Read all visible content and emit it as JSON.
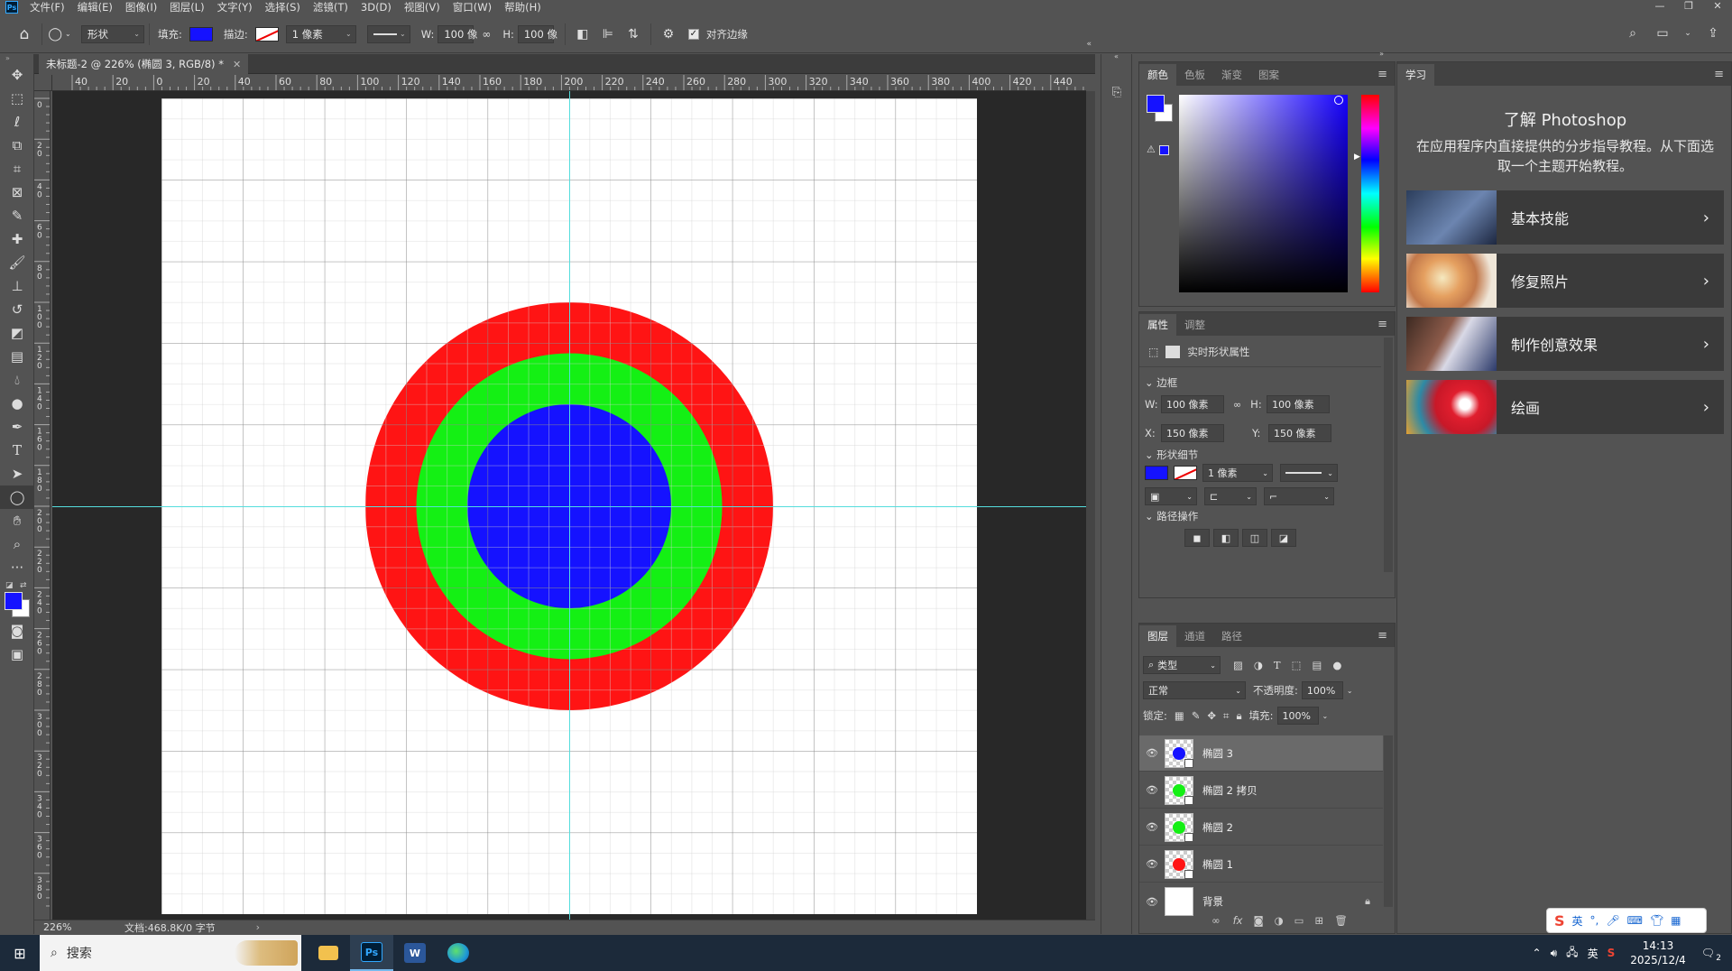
{
  "app": {
    "logo": "Ps"
  },
  "menu": [
    "文件(F)",
    "编辑(E)",
    "图像(I)",
    "图层(L)",
    "文字(Y)",
    "选择(S)",
    "滤镜(T)",
    "3D(D)",
    "视图(V)",
    "窗口(W)",
    "帮助(H)"
  ],
  "options": {
    "shape_mode": "形状",
    "fill_label": "填充:",
    "fill_color": "#1512ff",
    "stroke_label": "描边:",
    "stroke_width": "1 像素",
    "w_label": "W:",
    "w_value": "100 像",
    "h_label": "H:",
    "h_value": "100 像",
    "align_edges_label": "对齐边缘"
  },
  "document": {
    "tab_title": "未标题-2 @ 226% (椭圆 3, RGB/8) *",
    "ruler_h_ticks": [
      "40",
      "20",
      "0",
      "20",
      "40",
      "60",
      "80",
      "100",
      "120",
      "140",
      "160",
      "180",
      "200",
      "220",
      "240",
      "260",
      "280",
      "300",
      "320",
      "340",
      "360",
      "380",
      "400",
      "420",
      "440"
    ],
    "ruler_v_ticks": [
      "0",
      "2\n0",
      "4\n0",
      "6\n0",
      "8\n0",
      "1\n0\n0",
      "1\n2\n0",
      "1\n4\n0",
      "1\n6\n0",
      "1\n8\n0",
      "2\n0\n0",
      "2\n2\n0",
      "2\n4\n0",
      "2\n6\n0",
      "2\n8\n0",
      "3\n0\n0",
      "3\n2\n0",
      "3\n4\n0",
      "3\n6\n0",
      "3\n8\n0"
    ],
    "colors": {
      "outer": "#ff1414",
      "middle": "#14f014",
      "inner": "#1512ff",
      "guide": "#55dddd"
    }
  },
  "status": {
    "zoom": "226%",
    "doc_info": "文档:468.8K/0 字节",
    "arrow": "›"
  },
  "color_panel": {
    "tabs": [
      "颜色",
      "色板",
      "渐变",
      "图案"
    ],
    "fg": "#1512ff",
    "bg": "#ffffff"
  },
  "props_panel": {
    "tabs": [
      "属性",
      "调整"
    ],
    "header": "实时形状属性",
    "bounds_title": "边框",
    "w_label": "W:",
    "w_value": "100 像素",
    "h_label": "H:",
    "h_value": "100 像素",
    "x_label": "X:",
    "x_value": "150 像素",
    "y_label": "Y:",
    "y_value": "150 像素",
    "shape_title": "形状细节",
    "stroke_width": "1 像素",
    "path_ops_title": "路径操作"
  },
  "layers_panel": {
    "tabs": [
      "图层",
      "通道",
      "路径"
    ],
    "filter_label": "类型",
    "blend_mode": "正常",
    "opacity_label": "不透明度:",
    "opacity_value": "100%",
    "lock_label": "锁定:",
    "fill_label": "填充:",
    "fill_value": "100%",
    "layers": [
      {
        "name": "椭圆 3",
        "color": "#1512ff",
        "selected": true
      },
      {
        "name": "椭圆 2 拷贝",
        "color": "#14f014",
        "selected": false
      },
      {
        "name": "椭圆 2",
        "color": "#14f014",
        "selected": false
      },
      {
        "name": "椭圆 1",
        "color": "#ff1414",
        "selected": false
      },
      {
        "name": "背景",
        "color": "",
        "selected": false
      }
    ]
  },
  "learn_panel": {
    "tab": "学习",
    "title": "了解 Photoshop",
    "desc": "在应用程序内直接提供的分步指导教程。从下面选取一个主题开始教程。",
    "cards": [
      "基本技能",
      "修复照片",
      "制作创意效果",
      "绘画"
    ]
  },
  "taskbar": {
    "search_placeholder": "搜索",
    "ime_lang": "英",
    "time": "14:13",
    "date": "2025/12/4",
    "notif_count": "2"
  },
  "ime": {
    "mode": "英"
  }
}
